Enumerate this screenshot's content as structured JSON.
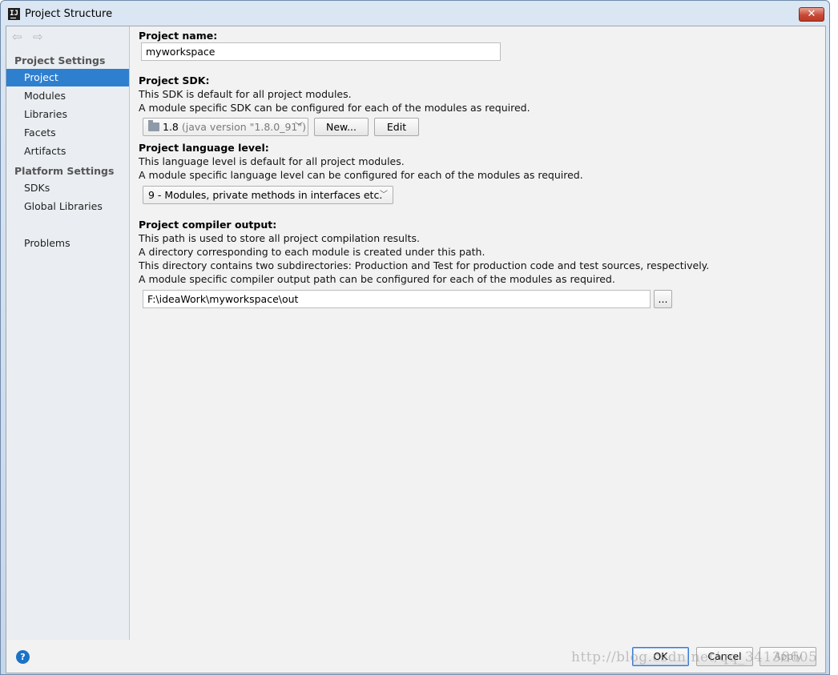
{
  "window": {
    "title": "Project Structure",
    "app_icon_text": "IJ",
    "close_glyph": "✕"
  },
  "nav": {
    "back_glyph": "⇦",
    "forward_glyph": "⇨"
  },
  "sidebar": {
    "project_settings_header": "Project Settings",
    "platform_settings_header": "Platform Settings",
    "items": [
      {
        "label": "Project",
        "selected": true
      },
      {
        "label": "Modules"
      },
      {
        "label": "Libraries"
      },
      {
        "label": "Facets"
      },
      {
        "label": "Artifacts"
      },
      {
        "label": "SDKs"
      },
      {
        "label": "Global Libraries"
      },
      {
        "label": "Problems"
      }
    ]
  },
  "project_name": {
    "label": "Project name:",
    "value": "myworkspace"
  },
  "project_sdk": {
    "label": "Project SDK:",
    "desc1": "This SDK is default for all project modules.",
    "desc2": "A module specific SDK can be configured for each of the modules as required.",
    "selected_version": "1.8",
    "selected_detail": "(java version \"1.8.0_91\")",
    "new_button": "New...",
    "edit_button": "Edit"
  },
  "language_level": {
    "label": "Project language level:",
    "desc1": "This language level is default for all project modules.",
    "desc2": "A module specific language level can be configured for each of the modules as required.",
    "selected": "9 - Modules, private methods in interfaces etc."
  },
  "compiler_output": {
    "label": "Project compiler output:",
    "desc1": "This path is used to store all project compilation results.",
    "desc2": "A directory corresponding to each module is created under this path.",
    "desc3": "This directory contains two subdirectories: Production and Test for production code and test sources, respectively.",
    "desc4": "A module specific compiler output path can be configured for each of the modules as required.",
    "path": "F:\\ideaWork\\myworkspace\\out",
    "browse_button": "..."
  },
  "footer": {
    "help_glyph": "?",
    "ok_button": "OK",
    "cancel_button": "Cancel",
    "apply_button": "Apply",
    "watermark": "http://blog.csdn.net/qq_34138605"
  },
  "colors": {
    "selection": "#2f7fcf",
    "help": "#1a73c7",
    "close": "#c74a36"
  }
}
